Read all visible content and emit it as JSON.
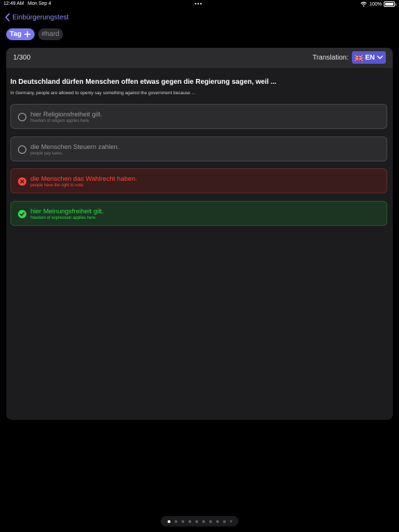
{
  "status": {
    "time": "12:49 AM",
    "date": "Mon Sep 4",
    "dots": "•••",
    "battery": "100%",
    "battery_level": 1.0
  },
  "nav": {
    "back_label": "Einbürgerungstest"
  },
  "tags": {
    "add_label": "Tag",
    "items": [
      "#hard"
    ]
  },
  "card": {
    "counter": "1/300",
    "translation_label": "Translation:",
    "language_code": "EN",
    "question": "In Deutschland dürfen Menschen offen etwas gegen die Regierung sagen, weil ...",
    "question_translation": "In Germany, people are allowed to openly say something against the government because ...",
    "answers": [
      {
        "text": "hier Religionsfreiheit gilt.",
        "translation": "freedom of religion applies here.",
        "state": "neutral"
      },
      {
        "text": "die Menschen Steuern zahlen.",
        "translation": "people pay taxes.",
        "state": "neutral"
      },
      {
        "text": "die Menschen das Wahlrecht haben.",
        "translation": "people have the right to vote.",
        "state": "wrong"
      },
      {
        "text": "hier Meinungsfreiheit gilt.",
        "translation": "freedom of expression applies here.",
        "state": "correct"
      }
    ]
  },
  "colors": {
    "accent": "#7b78f2",
    "correct": "#32d74b",
    "wrong": "#ff453a",
    "language_select": "#5856d6"
  },
  "pager": {
    "count": 10,
    "active_index": 0
  }
}
